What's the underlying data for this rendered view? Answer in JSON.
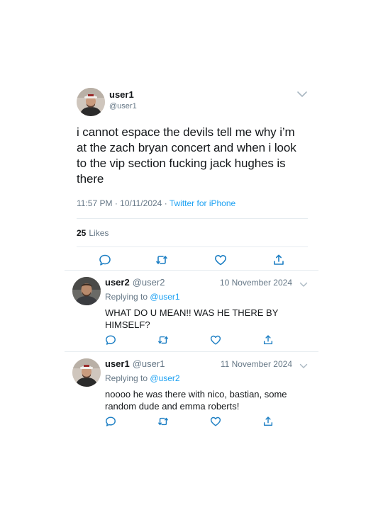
{
  "main_tweet": {
    "display_name": "user1",
    "handle": "@user1",
    "text": "i cannot espace the devils tell me why i’m at the zach bryan concert and when i look to the vip section fucking jack hughes is there",
    "time": "11:57 PM",
    "date": "10/11/2024",
    "source": "Twitter for iPhone",
    "likes_count": "25",
    "likes_label": "Likes"
  },
  "replies": [
    {
      "display_name": "user2",
      "handle": "@user2",
      "date": "10 November 2024",
      "replying_label": "Replying to",
      "replying_to": "@user1",
      "text": "WHAT DO U MEAN!! WAS HE THERE BY HIMSELF?"
    },
    {
      "display_name": "user1",
      "handle": "@user1",
      "date": "11 November 2024",
      "replying_label": "Replying to",
      "replying_to": "@user2",
      "text": "noooo he was there with nico, bastian, some random dude and emma roberts!"
    }
  ],
  "icons": [
    "reply-icon",
    "retweet-icon",
    "like-icon",
    "share-icon",
    "chevron-down-icon"
  ],
  "colors": {
    "link": "#1da1f2",
    "secondary_text": "#657786",
    "icon": "#1d7fc4",
    "divider": "#e6ecf0"
  }
}
